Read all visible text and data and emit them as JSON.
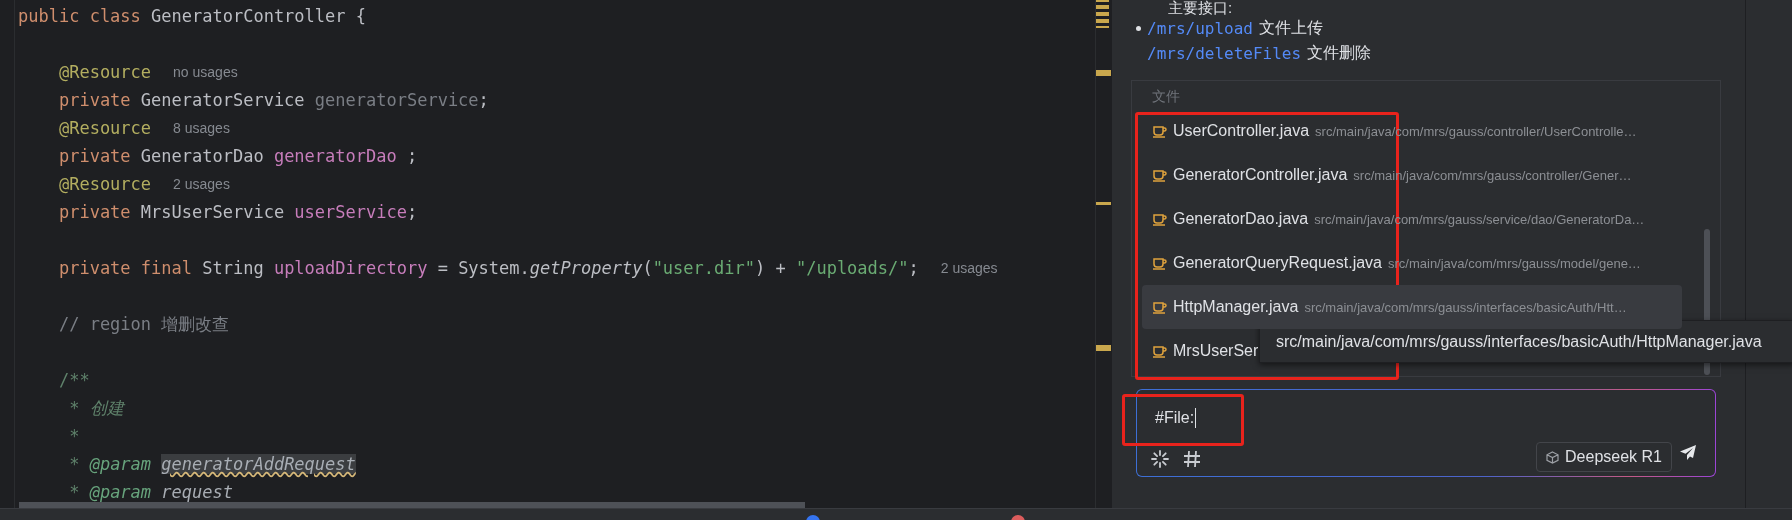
{
  "editor": {
    "lines": [
      {
        "tokens": [
          {
            "text": "public class ",
            "kind": "keyword"
          },
          {
            "text": "GeneratorController {",
            "kind": "plain"
          }
        ]
      },
      {
        "kind": "blank"
      },
      {
        "tokens": [
          {
            "text": "    @Resource",
            "kind": "annotation"
          }
        ],
        "hint": "no usages"
      },
      {
        "tokens": [
          {
            "text": "    private ",
            "kind": "keyword"
          },
          {
            "text": "GeneratorService ",
            "kind": "plain"
          },
          {
            "text": "generatorService",
            "kind": "unused"
          },
          {
            "text": ";",
            "kind": "plain"
          }
        ]
      },
      {
        "tokens": [
          {
            "text": "    @Resource",
            "kind": "annotation"
          }
        ],
        "hint": "8 usages"
      },
      {
        "tokens": [
          {
            "text": "    private ",
            "kind": "keyword"
          },
          {
            "text": "GeneratorDao ",
            "kind": "plain"
          },
          {
            "text": "generatorDao",
            "kind": "field"
          },
          {
            "text": " ;",
            "kind": "plain"
          }
        ]
      },
      {
        "tokens": [
          {
            "text": "    @Resource",
            "kind": "annotation"
          }
        ],
        "hint": "2 usages"
      },
      {
        "tokens": [
          {
            "text": "    private ",
            "kind": "keyword"
          },
          {
            "text": "MrsUserService ",
            "kind": "plain"
          },
          {
            "text": "userService",
            "kind": "field"
          },
          {
            "text": ";",
            "kind": "plain"
          }
        ]
      },
      {
        "kind": "blank"
      },
      {
        "tokens": [
          {
            "text": "    private final ",
            "kind": "keyword"
          },
          {
            "text": "String ",
            "kind": "plain"
          },
          {
            "text": "uploadDirectory",
            "kind": "field"
          },
          {
            "text": " = System.",
            "kind": "plain"
          },
          {
            "text": "getProperty",
            "kind": "method"
          },
          {
            "text": "(",
            "kind": "plain"
          },
          {
            "text": "\"user.dir\"",
            "kind": "string"
          },
          {
            "text": ") + ",
            "kind": "plain"
          },
          {
            "text": "\"/uploads/\"",
            "kind": "string"
          },
          {
            "text": ";",
            "kind": "plain"
          }
        ],
        "hint": "2 usages"
      },
      {
        "kind": "blank"
      },
      {
        "tokens": [
          {
            "text": "    // region 增删改查",
            "kind": "comment"
          }
        ]
      },
      {
        "kind": "blank"
      },
      {
        "tokens": [
          {
            "text": "    /**",
            "kind": "doc"
          }
        ]
      },
      {
        "tokens": [
          {
            "text": "     * ",
            "kind": "doc"
          },
          {
            "text": "创建",
            "kind": "doc_text"
          }
        ]
      },
      {
        "tokens": [
          {
            "text": "     *",
            "kind": "doc"
          }
        ]
      },
      {
        "tokens": [
          {
            "text": "     * ",
            "kind": "doc"
          },
          {
            "text": "@param ",
            "kind": "doc_tag"
          },
          {
            "text": "generatorAddRequest",
            "kind": "param_warn"
          }
        ]
      },
      {
        "tokens": [
          {
            "text": "     * ",
            "kind": "doc"
          },
          {
            "text": "@param ",
            "kind": "doc_tag"
          },
          {
            "text": "request",
            "kind": "doc_param"
          }
        ]
      }
    ]
  },
  "chat": {
    "intro": "主要接口:",
    "bullets": [
      {
        "path": "/mrs/upload",
        "text": "文件上传",
        "bullet": true
      },
      {
        "path": "/mrs/deleteFiles",
        "text": "文件删除",
        "bullet": false
      }
    ]
  },
  "file_popup": {
    "header": "文件",
    "items": [
      {
        "name": "UserController.java",
        "path": "src/main/java/com/mrs/gauss/controller/UserControlle…",
        "selected": false
      },
      {
        "name": "GeneratorController.java",
        "path": "src/main/java/com/mrs/gauss/controller/Gener…",
        "selected": false
      },
      {
        "name": "GeneratorDao.java",
        "path": "src/main/java/com/mrs/gauss/service/dao/GeneratorDa…",
        "selected": false
      },
      {
        "name": "GeneratorQueryRequest.java",
        "path": "src/main/java/com/mrs/gauss/model/gene…",
        "selected": false
      },
      {
        "name": "HttpManager.java",
        "path": "src/main/java/com/mrs/gauss/interfaces/basicAuth/Htt…",
        "selected": true
      },
      {
        "name": "MrsUserSer",
        "selected": false
      }
    ]
  },
  "tooltip": "src/main/java/com/mrs/gauss/interfaces/basicAuth/HttpManager.java",
  "input": {
    "value": "#File:",
    "model": "Deepseek R1"
  }
}
